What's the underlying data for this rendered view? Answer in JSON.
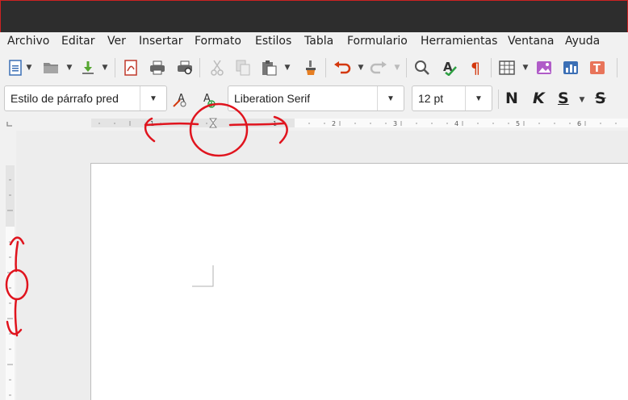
{
  "menu": [
    "Archivo",
    "Editar",
    "Ver",
    "Insertar",
    "Formato",
    "Estilos",
    "Tabla",
    "Formulario",
    "Herramientas",
    "Ventana",
    "Ayuda"
  ],
  "format_toolbar": {
    "paragraph_style": "Estilo de párrafo pred",
    "font_name": "Liberation Serif",
    "font_size": "12 pt",
    "bold_label": "N",
    "italic_label": "K",
    "underline_label": "S",
    "strike_label": "S"
  },
  "ruler": {
    "numbers": [
      "1",
      "1",
      "2",
      "3",
      "4",
      "5",
      "6"
    ]
  },
  "colors": {
    "accent_red": "#d4380d",
    "annotation_red": "#e0141e",
    "titlebar": "#2d2d2d"
  },
  "icons": [
    "new-document-icon",
    "open-folder-icon",
    "save-icon",
    "export-pdf-icon",
    "print-icon",
    "print-preview-icon",
    "cut-icon",
    "copy-icon",
    "paste-icon",
    "clone-format-icon",
    "undo-icon",
    "redo-icon",
    "find-replace-icon",
    "spellcheck-icon",
    "formatting-marks-icon",
    "insert-table-icon",
    "insert-image-icon",
    "insert-chart-icon",
    "insert-textbox-icon",
    "clear-formatting-icon",
    "update-style-icon"
  ]
}
